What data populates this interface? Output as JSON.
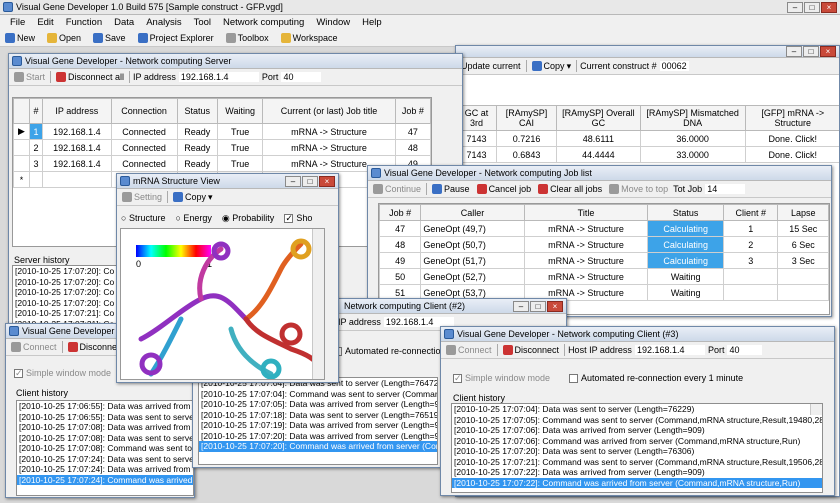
{
  "app": {
    "title": "Visual Gene Developer 1.0 Build 575   [Sample construct - GFP.vgd]",
    "menu": [
      "File",
      "Edit",
      "Function",
      "Data",
      "Analysis",
      "Tool",
      "Network computing",
      "Window",
      "Help"
    ],
    "toolbar": {
      "new": "New",
      "open": "Open",
      "save": "Save",
      "project": "Project Explorer",
      "toolbox": "Toolbox",
      "workspace": "Workspace"
    }
  },
  "construct": {
    "update": "Update current",
    "copy": "Copy",
    "current_label": "Current construct #",
    "current_value": "00062",
    "headers": [
      "GC at 3rd",
      "[RAmySP] CAI",
      "[RAmySP] Overall GC",
      "[RAmySP] Mismatched DNA",
      "[GFP] mRNA -> Structure"
    ],
    "rows": [
      [
        "7143",
        "0.7216",
        "48.6111",
        "36.0000",
        "Done. Click!"
      ],
      [
        "7143",
        "0.6843",
        "44.4444",
        "33.0000",
        "Done. Click!"
      ]
    ]
  },
  "server": {
    "title": "Visual Gene Developer - Network computing Server",
    "start": "Start",
    "disconnect_all": "Disconnect all",
    "ip_label": "IP address",
    "ip": "192.168.1.4",
    "port_label": "Port",
    "port": "40",
    "headers": [
      "#",
      "IP address",
      "Connection",
      "Status",
      "Waiting",
      "Current (or last) Job title",
      "Job #"
    ],
    "rows": [
      [
        "1",
        "192.168.1.4",
        "Connected",
        "Ready",
        "True",
        "mRNA -> Structure",
        "47"
      ],
      [
        "2",
        "192.168.1.4",
        "Connected",
        "Ready",
        "True",
        "mRNA -> Structure",
        "48"
      ],
      [
        "3",
        "192.168.1.4",
        "Connected",
        "Ready",
        "True",
        "mRNA -> Structure",
        "49"
      ]
    ],
    "new_row": "*",
    "history_label": "Server history",
    "history": [
      "[2010-10-25 17:07:20]: Co",
      "[2010-10-25 17:07:20]: Co",
      "[2010-10-25 17:07:20]: Co",
      "[2010-10-25 17:07:20]: Co",
      "[2010-10-25 17:07:21]: Co",
      "[2010-10-25 17:07:21]: Co",
      "[2010-10-25 17:07:22]: Co",
      "[2010-10-25 17:07:22]: Co"
    ]
  },
  "mrna": {
    "title": "mRNA Structure View",
    "setting": "Setting",
    "copy": "Copy",
    "structure": "Structure",
    "energy": "Energy",
    "probability": "Probability",
    "show": "Sho",
    "scale_min": "0",
    "scale_max": "1"
  },
  "joblist": {
    "title": "Visual Gene Developer - Network computing Job list",
    "continue": "Continue",
    "pause": "Pause",
    "cancel": "Cancel job",
    "clear": "Clear all jobs",
    "move_top": "Move to top",
    "tot_label": "Tot Job",
    "tot": "14",
    "headers": [
      "Job #",
      "Caller",
      "Title",
      "Status",
      "Client #",
      "Lapse"
    ],
    "rows": [
      [
        "47",
        "GeneOpt (49,7)",
        "mRNA -> Structure",
        "Calculating",
        "1",
        "15 Sec"
      ],
      [
        "48",
        "GeneOpt (50,7)",
        "mRNA -> Structure",
        "Calculating",
        "2",
        "6 Sec"
      ],
      [
        "49",
        "GeneOpt (51,7)",
        "mRNA -> Structure",
        "Calculating",
        "3",
        "3 Sec"
      ],
      [
        "50",
        "GeneOpt (52,7)",
        "mRNA -> Structure",
        "Waiting",
        "",
        ""
      ],
      [
        "51",
        "GeneOpt (53,7)",
        "mRNA -> Structure",
        "Waiting",
        "",
        ""
      ]
    ]
  },
  "client1": {
    "title": "Visual Gene Developer - Network",
    "connect": "Connect",
    "disconnect": "Disconne",
    "simple": "Simple window mode",
    "history_label": "Client history",
    "history": [
      "[2010-10-25 17:06:55]: Data was arrived from",
      "[2010-10-25 17:06:55]: Data was sent to server",
      "[2010-10-25 17:07:08]: Data was arrived from",
      "[2010-10-25 17:07:08]: Data was sent to server",
      "[2010-10-25 17:07:08]: Command was sent to s",
      "[2010-10-25 17:07:24]: Data was sent to server",
      "[2010-10-25 17:07:24]: Data was arrived from",
      "[2010-10-25 17:07:24]: Command was arrived fr"
    ]
  },
  "client2": {
    "title": "Network computing Client (#2)",
    "ip_label": "IP address",
    "ip": "192.168.1.4",
    "reconnect": "Automated re-connection every",
    "history": [
      "[2010-10-25 17:07:04]: Data was sent to server (Length=76472)",
      "[2010-10-25 17:07:04]: Command was sent to server (Command,mRNA structure,Result,",
      "[2010-10-25 17:07:05]: Data was arrived from server (Length=909)",
      "[2010-10-25 17:07:18]: Data was sent to server (Length=76519)",
      "[2010-10-25 17:07:19]: Data was arrived from server (Length=909)",
      "[2010-10-25 17:07:20]: Data was arrived from server (Length=909)",
      "[2010-10-25 17:07:20]: Command was arrived from server (Command,mRNA structure,Result,19609,2"
    ]
  },
  "client3": {
    "title": "Visual Gene Developer - Network computing Client (#3)",
    "connect": "Connect",
    "disconnect": "Disconnect",
    "host_label": "Host IP address",
    "host": "192.168.1.4",
    "port_label": "Port",
    "port": "40",
    "simple": "Simple window mode",
    "reconnect": "Automated re-connection every 1 minute",
    "history_label": "Client history",
    "history": [
      "[2010-10-25 17:07:04]: Data was sent to server (Length=76229)",
      "[2010-10-25 17:07:05]: Command was sent to server (Command,mRNA structure,Result,19480,28",
      "[2010-10-25 17:07:06]: Data was arrived from server (Length=909)",
      "[2010-10-25 17:07:06]: Command was arrived from server (Command,mRNA structure,Run)",
      "[2010-10-25 17:07:20]: Data was sent to server (Length=76306)",
      "[2010-10-25 17:07:21]: Command was sent to server (Command,mRNA structure,Result,19506,28",
      "[2010-10-25 17:07:22]: Data was arrived from server (Length=909)",
      "[2010-10-25 17:07:22]: Command was arrived from server (Command,mRNA structure,Run)"
    ]
  }
}
